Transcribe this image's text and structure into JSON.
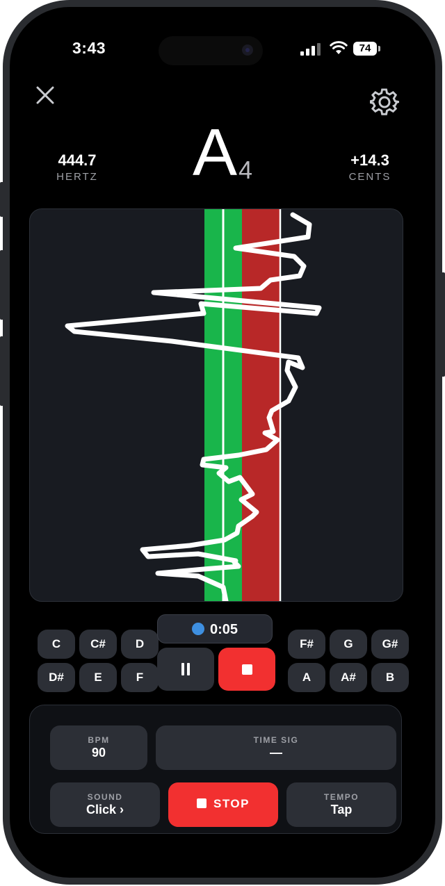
{
  "status": {
    "time": "3:43",
    "battery": "74"
  },
  "header": {
    "close_icon": "close-icon",
    "settings_icon": "gear-icon"
  },
  "readout": {
    "hertz_value": "444.7",
    "hertz_label": "HERTZ",
    "note": "A",
    "octave": "4",
    "cents_value": "+14.3",
    "cents_label": "CENTS"
  },
  "colors": {
    "in_tune": "#19b54b",
    "sharp": "#b82828",
    "stop": "#f23030",
    "background": "#000000"
  },
  "keys": {
    "row1_left": [
      "C",
      "C#",
      "D"
    ],
    "row1_right": [
      "F#",
      "G",
      "G#"
    ],
    "row2_left": [
      "D#",
      "E",
      "F"
    ],
    "row2_right": [
      "A",
      "A#",
      "B"
    ]
  },
  "timer": {
    "value": "0:05"
  },
  "metronome": {
    "bpm_label": "BPM",
    "bpm_value": "90",
    "timesig_label": "TIME SIG",
    "timesig_value": "—",
    "sound_label": "SOUND",
    "sound_value": "Click ›",
    "stop_label": "STOP",
    "tempo_label": "TEMPO",
    "tempo_value": "Tap"
  }
}
